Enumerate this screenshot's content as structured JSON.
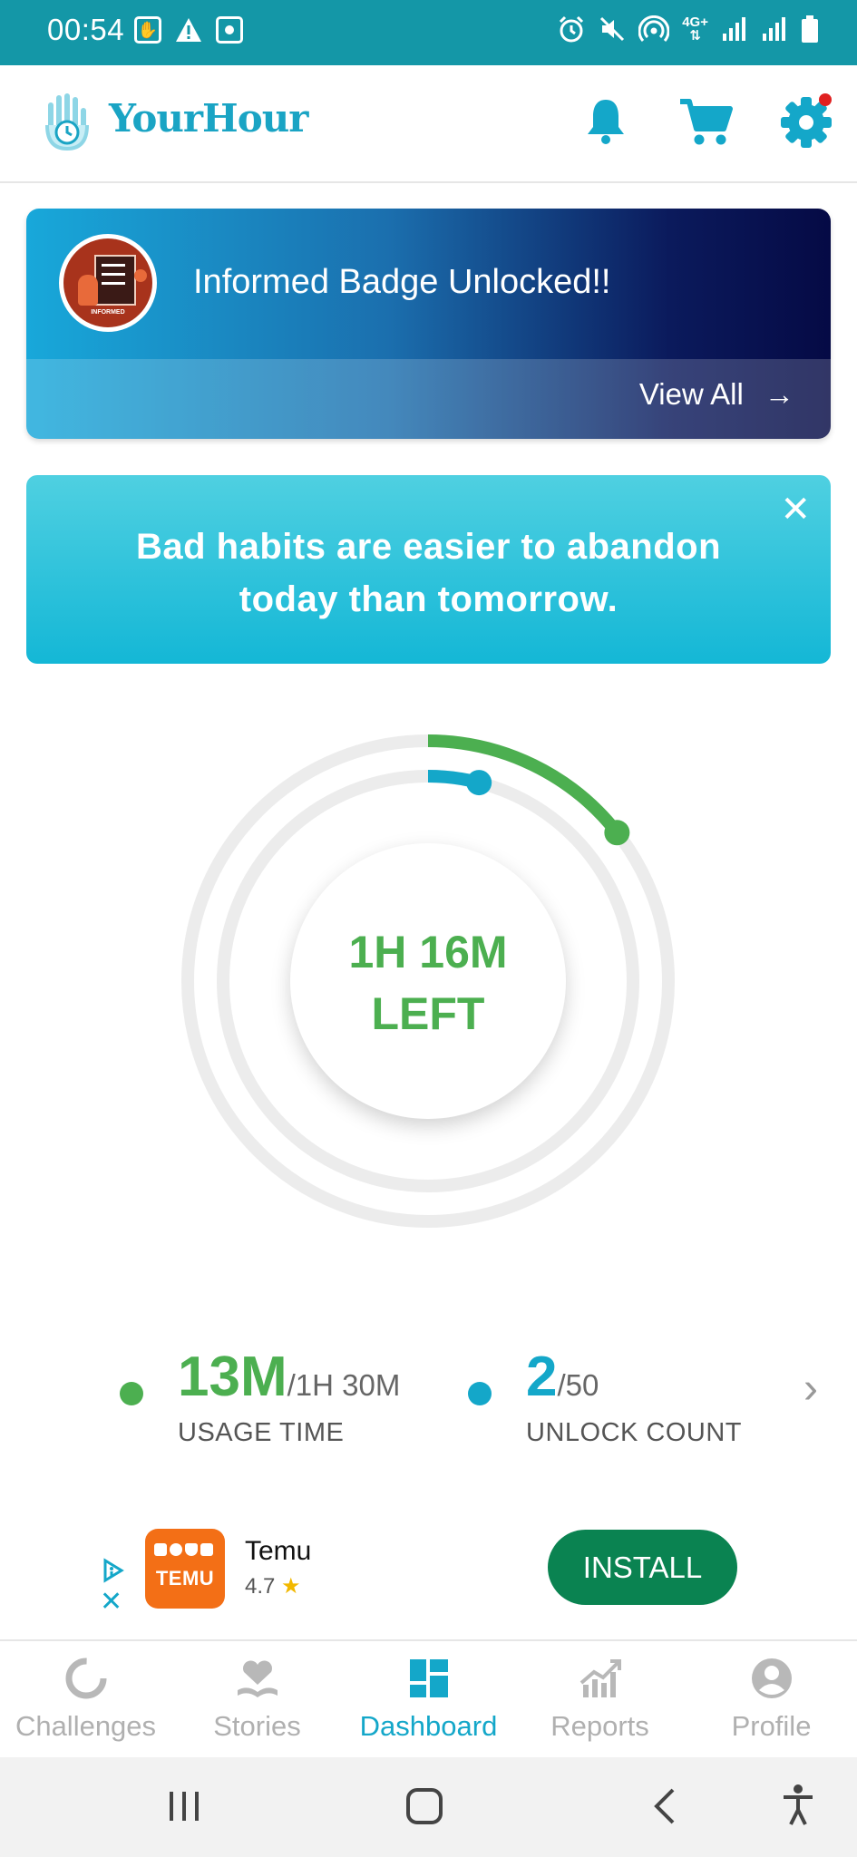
{
  "status_bar": {
    "time": "00:54",
    "left_icons": [
      "yourhour-notification-icon",
      "warning-icon",
      "screen-record-icon"
    ],
    "right_icons": [
      "alarm-icon",
      "mute-icon",
      "hotspot-icon",
      "network-4g-icon",
      "signal-icon",
      "signal-icon",
      "battery-icon"
    ],
    "network_label": "4G+"
  },
  "header": {
    "app_name": "YourHour",
    "icons": [
      "bell-icon",
      "cart-icon",
      "gear-icon"
    ],
    "settings_has_notification_dot": true,
    "accent": "#14a7c9"
  },
  "badge_card": {
    "title": "Informed Badge Unlocked!!",
    "view_all": "View All",
    "arrow": "→",
    "badge_caption": "INFORMED"
  },
  "quote_card": {
    "line1": "Bad habits are easier to abandon",
    "line2": "today than tomorrow.",
    "close": "✕"
  },
  "dial": {
    "center_line1": "1H 16M",
    "center_line2": "LEFT",
    "usage_fraction": 0.144,
    "unlock_fraction": 0.04,
    "usage_color": "#4caf50",
    "unlock_color": "#14a7c9",
    "track_color": "#ececec"
  },
  "stats": {
    "usage": {
      "value": "13M",
      "limit": "/1H 30M",
      "label": "USAGE TIME",
      "color": "#4caf50"
    },
    "unlocks": {
      "value": "2",
      "limit": "/50",
      "label": "UNLOCK COUNT",
      "color": "#14a7c9"
    },
    "chevron": "›"
  },
  "ad": {
    "brand_icon_text": "TEMU",
    "name": "Temu",
    "rating": "4.7",
    "star": "★",
    "install": "INSTALL",
    "ad_choices_icon": "adchoices-icon",
    "close": "✕"
  },
  "bottom_nav": {
    "items": [
      {
        "label": "Challenges",
        "icon": "challenges-icon",
        "active": false
      },
      {
        "label": "Stories",
        "icon": "heart-book-icon",
        "active": false
      },
      {
        "label": "Dashboard",
        "icon": "dashboard-icon",
        "active": true
      },
      {
        "label": "Reports",
        "icon": "chart-icon",
        "active": false
      },
      {
        "label": "Profile",
        "icon": "person-icon",
        "active": false
      }
    ]
  },
  "system_nav": {
    "icons": [
      "recents-icon",
      "home-icon",
      "back-icon",
      "accessibility-icon"
    ]
  }
}
